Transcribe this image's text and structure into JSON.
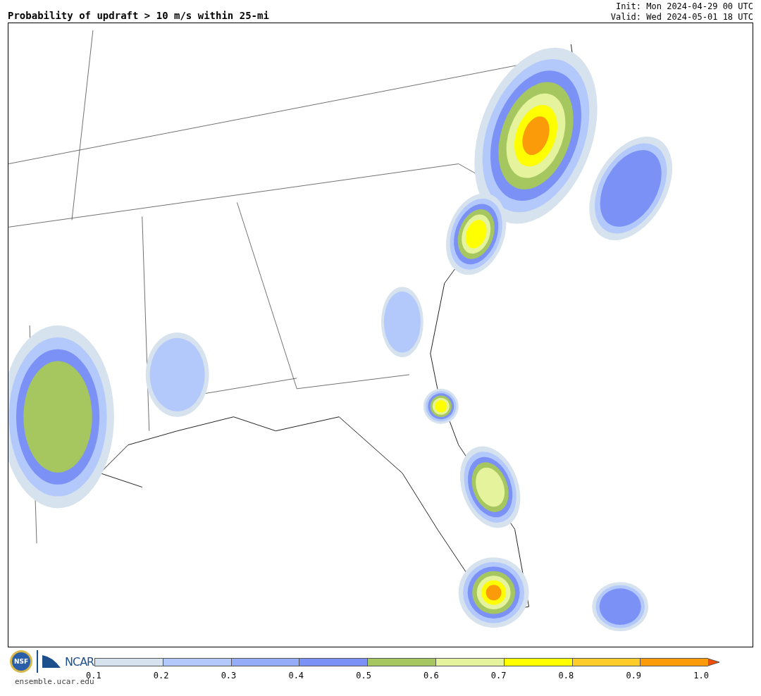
{
  "title": "Probability of updraft > 10 m/s within 25-mi",
  "times": [
    "Init: Mon 2024-04-29 00 UTC",
    "Valid: Wed 2024-05-01 18 UTC"
  ],
  "logos": {
    "seal": "NSF",
    "org": "NCAR",
    "site": "ensemble.ucar.edu"
  },
  "colorbar": {
    "bins": [
      {
        "kind": "bin",
        "color": "#d6e2ed"
      },
      {
        "kind": "bin",
        "color": "#b3c8fb"
      },
      {
        "kind": "bin",
        "color": "#95acf8"
      },
      {
        "kind": "bin",
        "color": "#7b91f5"
      },
      {
        "kind": "bin",
        "color": "#a6c760"
      },
      {
        "kind": "bin",
        "color": "#e5f39d"
      },
      {
        "kind": "bin",
        "color": "#ffff00"
      },
      {
        "kind": "bin",
        "color": "#fdcc29"
      },
      {
        "kind": "bin",
        "color": "#fb9b09"
      },
      {
        "kind": "arrow",
        "color": "#ef4f0a"
      }
    ],
    "ticks": [
      "0.1",
      "0.2",
      "0.3",
      "0.4",
      "0.5",
      "0.6",
      "0.7",
      "0.8",
      "0.9",
      "1.0"
    ]
  }
}
